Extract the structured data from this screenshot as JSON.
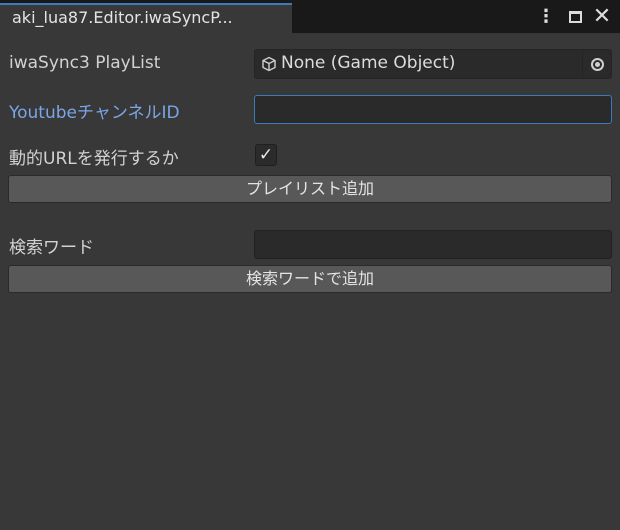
{
  "window": {
    "tab_title": "aki_lua87.Editor.iwaSyncP...",
    "menu_icon": "kebab-menu-icon",
    "maximize_icon": "maximize-icon",
    "close_icon": "close-icon",
    "menu_glyph": "⋮",
    "close_glyph": "✕"
  },
  "fields": {
    "playlist": {
      "label": "iwaSync3 PlayList",
      "value": "None (Game Object)",
      "icon": "cube-icon",
      "picker_icon": "object-picker-icon"
    },
    "channel_id": {
      "label": "YoutubeチャンネルID",
      "value": "",
      "placeholder": ""
    },
    "issue_url": {
      "label": "動的URLを発行するか",
      "checked": true,
      "check_glyph": "✓"
    },
    "search_word": {
      "label": "検索ワード",
      "value": "",
      "placeholder": ""
    }
  },
  "buttons": {
    "add_playlist": "プレイリスト追加",
    "add_by_search": "検索ワードで追加"
  },
  "colors": {
    "background": "#383838",
    "tabbar": "#191919",
    "accent": "#3a79bb",
    "link_label": "#7aa6e8",
    "button": "#585858"
  }
}
